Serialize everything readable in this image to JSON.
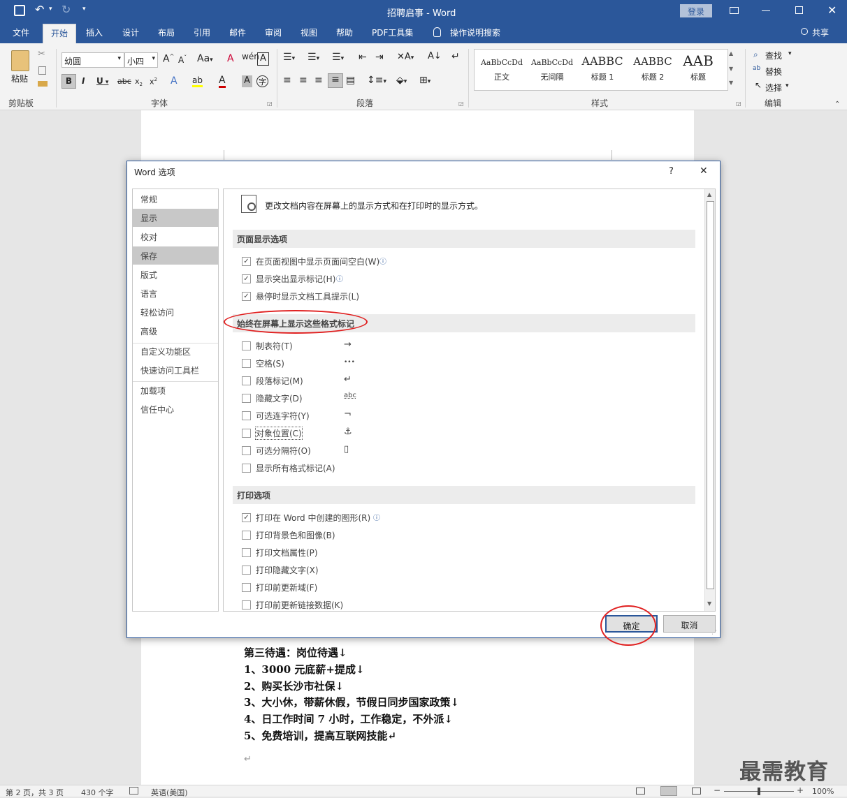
{
  "titlebar": {
    "doc_title": "招聘启事 - Word",
    "login": "登录"
  },
  "tabs": [
    "文件",
    "开始",
    "插入",
    "设计",
    "布局",
    "引用",
    "邮件",
    "审阅",
    "视图",
    "帮助",
    "PDF工具集",
    "操作说明搜索"
  ],
  "share": "共享",
  "ribbon": {
    "paste": "粘贴",
    "clipboard": "剪贴板",
    "font_name": "幼圆",
    "font_size": "小四",
    "font": "字体",
    "paragraph": "段落",
    "styles_group": "样式",
    "edit": "编辑",
    "find": "查找",
    "replace": "替换",
    "select": "选择",
    "styles": [
      {
        "sample": "AaBbCcDd",
        "name": "正文"
      },
      {
        "sample": "AaBbCcDd",
        "name": "无间隔"
      },
      {
        "sample": "AABBC",
        "name": "标题 1"
      },
      {
        "sample": "AABBC",
        "name": "标题 2"
      },
      {
        "sample": "AAB",
        "name": "标题"
      }
    ]
  },
  "dialog": {
    "title": "Word 选项",
    "help": "?",
    "close": "✕",
    "nav": [
      "常规",
      "显示",
      "校对",
      "保存",
      "版式",
      "语言",
      "轻松访问",
      "高级",
      "自定义功能区",
      "快速访问工具栏",
      "加载项",
      "信任中心"
    ],
    "intro": "更改文档内容在屏幕上的显示方式和在打印时的显示方式。",
    "sec1": "页面显示选项",
    "page_opts": [
      "在页面视图中显示页面间空白(W)",
      "显示突出显示标记(H)",
      "悬停时显示文档工具提示(L)"
    ],
    "sec2": "始终在屏幕上显示这些格式标记",
    "marks": [
      {
        "label": "制表符(T)",
        "sym": "→"
      },
      {
        "label": "空格(S)",
        "sym": "•••"
      },
      {
        "label": "段落标记(M)",
        "sym": "↵"
      },
      {
        "label": "隐藏文字(D)",
        "sym": "abc"
      },
      {
        "label": "可选连字符(Y)",
        "sym": "¬"
      },
      {
        "label": "对象位置(C)",
        "sym": "⚓"
      },
      {
        "label": "可选分隔符(O)",
        "sym": "▯"
      },
      {
        "label": "显示所有格式标记(A)",
        "sym": ""
      }
    ],
    "sec3": "打印选项",
    "print_opts": [
      "打印在 Word 中创建的图形(R)",
      "打印背景色和图像(B)",
      "打印文档属性(P)",
      "打印隐藏文字(X)",
      "打印前更新域(F)",
      "打印前更新链接数据(K)"
    ],
    "ok": "确定",
    "cancel": "取消"
  },
  "doc": {
    "lines": [
      "第三待遇：岗位待遇↓",
      "1、3000 元底薪+提成↓",
      "2、购买长沙市社保↓",
      "3、大小休，带薪休假，节假日同步国家政策↓",
      "4、日工作时间 7 小时，工作稳定，不外派↓",
      "5、免费培训，提高互联网技能↵"
    ],
    "empty_para": "↵"
  },
  "status": {
    "page": "第 2 页，共 3 页",
    "words": "430 个字",
    "lang": "英语(美国)",
    "zoom": "100%"
  },
  "watermark": "最需教育"
}
